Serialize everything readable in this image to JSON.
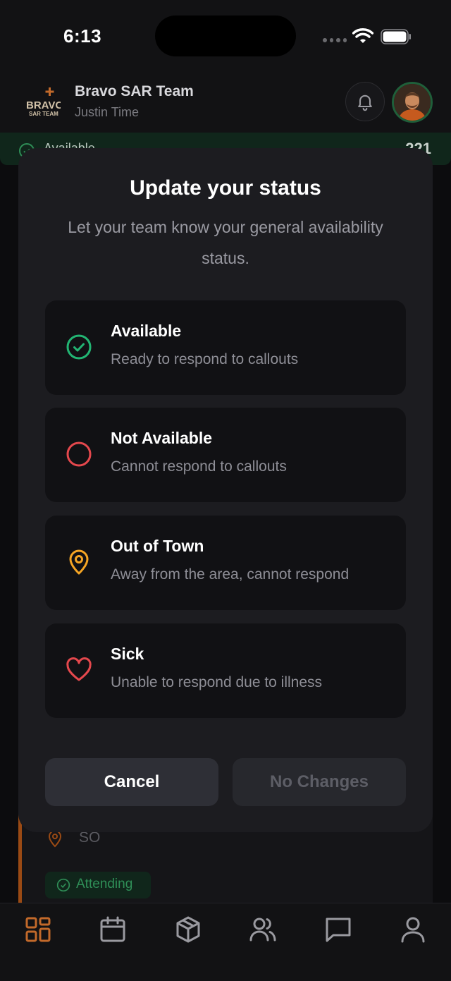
{
  "status_bar": {
    "time": "6:13"
  },
  "header": {
    "logo_text_top": "BRAVO",
    "logo_text_bottom": "SAR TEAM",
    "team_name": "Bravo SAR Team",
    "user_name": "Justin Time"
  },
  "status_strip": {
    "label": "Available",
    "count": "221"
  },
  "modal": {
    "title": "Update your status",
    "description": "Let your team know your general availability status.",
    "options": [
      {
        "label": "Available",
        "sub": "Ready to respond to callouts",
        "icon": "check-circle-icon",
        "color": "#22b573"
      },
      {
        "label": "Not Available",
        "sub": "Cannot respond to callouts",
        "icon": "circle-icon",
        "color": "#e5484d"
      },
      {
        "label": "Out of Town",
        "sub": "Away from the area, cannot respond",
        "icon": "map-pin-icon",
        "color": "#f5a524"
      },
      {
        "label": "Sick",
        "sub": "Unable to respond due to illness",
        "icon": "heart-icon",
        "color": "#e5484d"
      }
    ],
    "cancel_label": "Cancel",
    "confirm_label": "No Changes"
  },
  "background_card": {
    "location": "SO",
    "attending_label": "Attending"
  },
  "colors": {
    "accent": "#c2692a",
    "available_green": "#22b573",
    "background": "#0c0c0e",
    "modal_bg": "#1c1c20"
  },
  "tabbar": [
    "grid-icon",
    "calendar-icon",
    "box-icon",
    "users-icon",
    "chat-icon",
    "profile-icon"
  ]
}
